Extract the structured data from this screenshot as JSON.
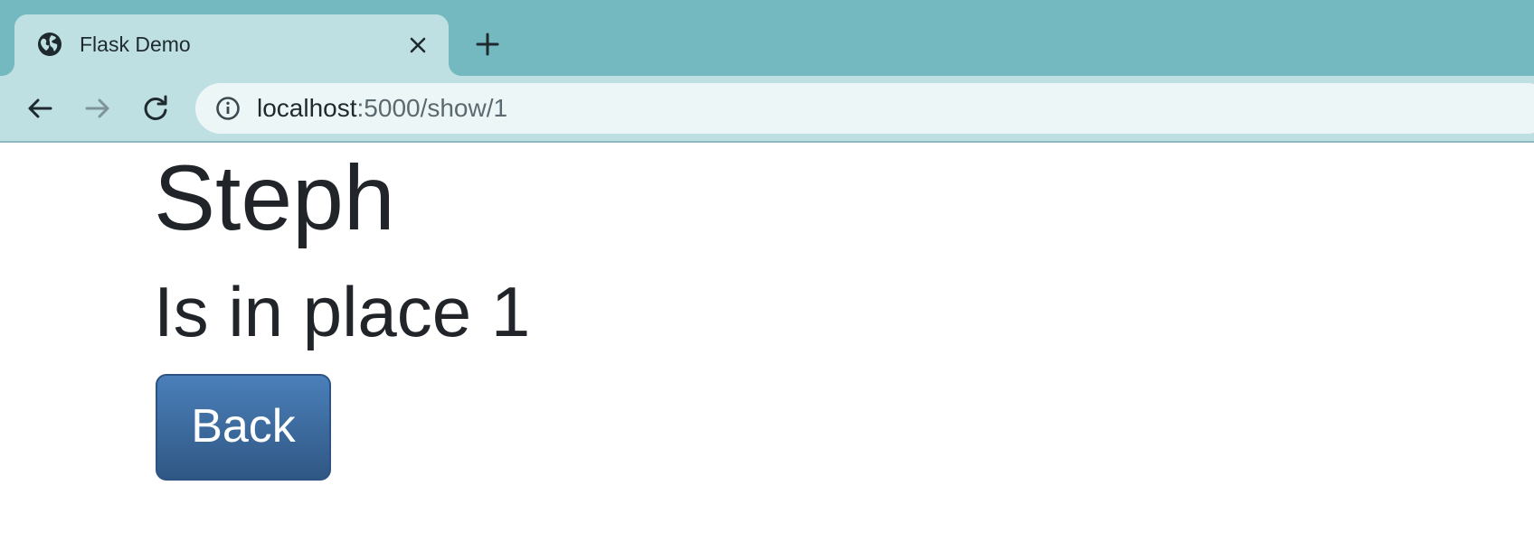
{
  "browser": {
    "tab": {
      "title": "Flask Demo",
      "favicon_icon": "globe-icon",
      "close_icon": "close-icon"
    },
    "new_tab_icon": "plus-icon",
    "nav": {
      "back_icon": "arrow-left-icon",
      "forward_icon": "arrow-right-icon",
      "reload_icon": "reload-icon"
    },
    "address_bar": {
      "info_icon": "info-icon",
      "host": "localhost",
      "rest": ":5000/show/1"
    },
    "colors": {
      "tabstrip": "#74b8c0",
      "toolbar": "#bfe0e3",
      "omnibox": "#ecf6f7"
    }
  },
  "page": {
    "name": "Steph",
    "place_text": "Is in place 1",
    "back_button_label": "Back",
    "colors": {
      "text": "#212529",
      "button": "#3a6ba3"
    }
  }
}
